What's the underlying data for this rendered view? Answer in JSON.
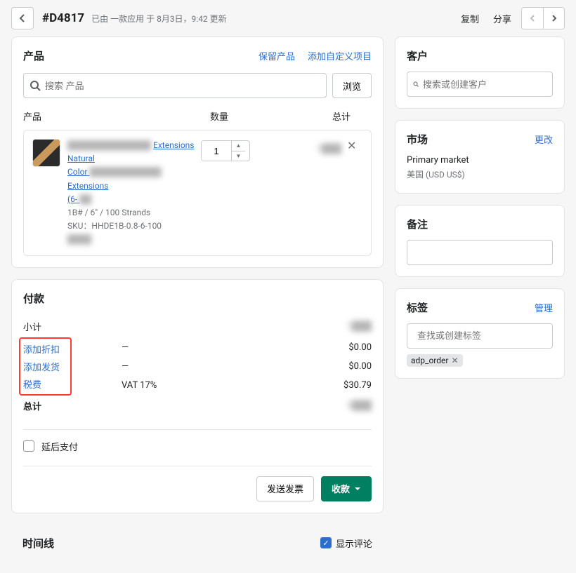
{
  "header": {
    "order_id": "#D4817",
    "subtitle": "已由 一款应用 于 8月3日，9:42 更新",
    "copy": "复制",
    "share": "分享"
  },
  "products": {
    "title": "产品",
    "reserve": "保留产品",
    "add_custom": "添加自定义项目",
    "search_placeholder": "搜索 产品",
    "browse": "浏览",
    "col_product": "产品",
    "col_qty": "数量",
    "col_total": "总计",
    "line": {
      "name_1": "Extensions Natural",
      "name_2": "Color",
      "name_3": "Extensions",
      "name_4": "(6-",
      "variant": "1B# / 6\" / 100 Strands",
      "sku": "SKU：HHDE1B-0.8-6-100",
      "hidden": "████",
      "qty": "1",
      "total": "$███"
    }
  },
  "payment": {
    "title": "付款",
    "rows": {
      "subtotal_label": "小计",
      "subtotal_val": "$███",
      "discount_label": "添加折扣",
      "discount_mid": "—",
      "discount_val": "$0.00",
      "shipping_label": "添加发货",
      "shipping_mid": "—",
      "shipping_val": "$0.00",
      "tax_label": "税费",
      "tax_mid": "VAT 17%",
      "tax_val": "$30.79",
      "total_label": "总计",
      "total_val": "$███"
    },
    "defer": "延后支付",
    "send_invoice": "发送发票",
    "collect": "收款"
  },
  "timeline": {
    "title": "时间线",
    "show_comments": "显示评论"
  },
  "customer": {
    "title": "客户",
    "placeholder": "搜索或创建客户"
  },
  "market": {
    "title": "市场",
    "change": "更改",
    "name": "Primary market",
    "currency": "美国 (USD US$)"
  },
  "notes": {
    "title": "备注"
  },
  "tags": {
    "title": "标签",
    "manage": "管理",
    "placeholder": "查找或创建标签",
    "chip": "adp_order"
  }
}
